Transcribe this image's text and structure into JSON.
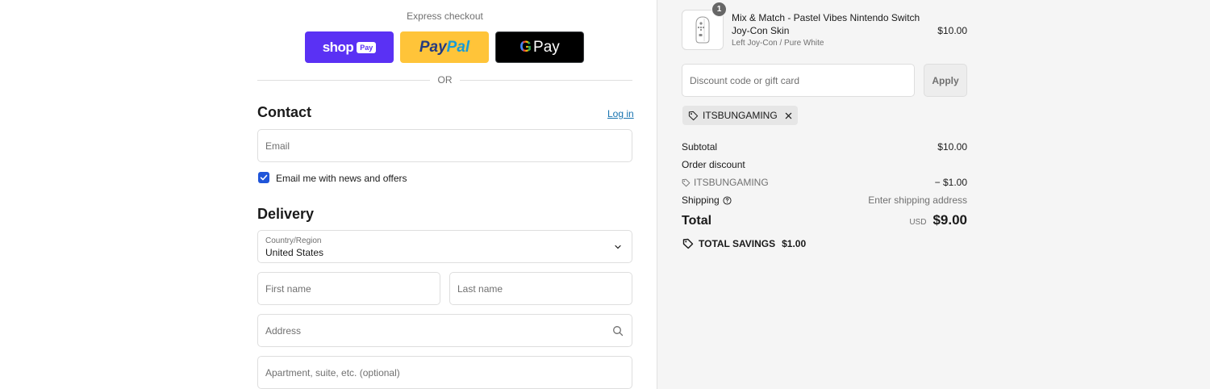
{
  "express": {
    "title": "Express checkout",
    "shop_pay": {
      "brand": "shop",
      "pill": "Pay"
    },
    "paypal": {
      "part1": "Pay",
      "part2": "Pal"
    },
    "gpay": {
      "g": "G",
      "pay": "Pay"
    },
    "or_text": "OR"
  },
  "contact": {
    "title": "Contact",
    "login_link": "Log in",
    "email_placeholder": "Email",
    "newsletter_label": "Email me with news and offers",
    "newsletter_checked": true
  },
  "delivery": {
    "title": "Delivery",
    "country_label": "Country/Region",
    "country_value": "United States",
    "first_name_placeholder": "First name",
    "last_name_placeholder": "Last name",
    "address_placeholder": "Address",
    "apartment_placeholder": "Apartment, suite, etc. (optional)"
  },
  "cart": {
    "quantity": "1",
    "product_name": "Mix & Match - Pastel Vibes Nintendo Switch Joy-Con Skin",
    "variant": "Left Joy-Con / Pure White",
    "price": "$10.00"
  },
  "discount": {
    "placeholder": "Discount code or gift card",
    "apply_label": "Apply",
    "applied_code": "ITSBUNGAMING"
  },
  "summary": {
    "subtotal_label": "Subtotal",
    "subtotal_value": "$10.00",
    "order_discount_label": "Order discount",
    "discount_code": "ITSBUNGAMING",
    "discount_value": "− $1.00",
    "shipping_label": "Shipping",
    "shipping_value": "Enter shipping address",
    "total_label": "Total",
    "currency": "USD",
    "total_value": "$9.00",
    "savings_label": "TOTAL SAVINGS",
    "savings_value": "$1.00"
  },
  "colors": {
    "shop_pay": "#5a31f4",
    "paypal": "#ffc439",
    "gpay": "#000000",
    "link": "#1773b0",
    "checkbox": "#1f55d9",
    "sidebar_bg": "#f5f5f5"
  },
  "icons": [
    "tag-icon",
    "close-icon",
    "info-icon",
    "chevron-down-icon",
    "search-icon",
    "check-icon",
    "savings-tag-icon"
  ]
}
